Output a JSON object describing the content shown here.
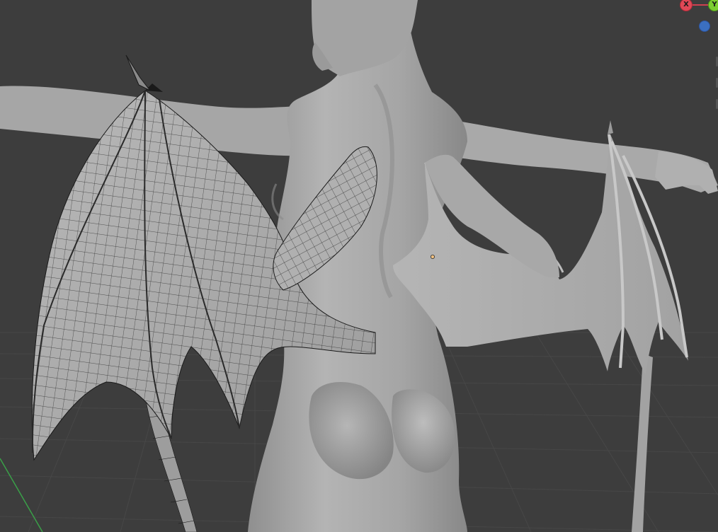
{
  "viewport": {
    "mode": "3D Viewport",
    "object_origin_color": "#f0c080"
  },
  "gizmo": {
    "x_label": "X",
    "y_label": "Y",
    "x_color": "#e04856",
    "y_color": "#7ccd33",
    "z_color": "#3b6fc1"
  },
  "colors": {
    "background": "#3d3d3d",
    "grid": "#474747",
    "mesh": "#a9a9a9",
    "mesh_dark": "#8a8a8a",
    "wire": "#1a1a1a",
    "axis_green": "#3aa048"
  }
}
